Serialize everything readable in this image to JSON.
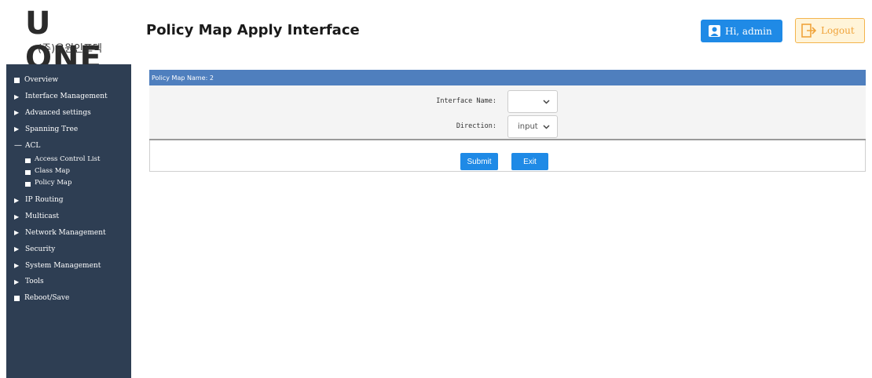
{
  "header": {
    "logo_main": "U ONE",
    "logo_sub": "(주)유원인포텍",
    "title": "Policy Map Apply Interface",
    "user_label": "Hi, admin",
    "logout_label": "Logout",
    "colors": {
      "user_btn": "#1f8ae6",
      "logout_border": "#f3b44d",
      "logout_text": "#f0a33a"
    }
  },
  "sidebar": {
    "items": [
      {
        "label": "Overview",
        "icon": "square-icon"
      },
      {
        "label": "Interface Management",
        "icon": "triangle-right-icon"
      },
      {
        "label": "Advanced settings",
        "icon": "triangle-right-icon"
      },
      {
        "label": "Spanning Tree",
        "icon": "triangle-right-icon"
      },
      {
        "label": "ACL",
        "icon": "minus-icon",
        "expanded": true,
        "children": [
          "Access Control List",
          "Class Map",
          "Policy Map"
        ]
      },
      {
        "label": "IP Routing",
        "icon": "triangle-right-icon"
      },
      {
        "label": "Multicast",
        "icon": "triangle-right-icon"
      },
      {
        "label": "Network Management",
        "icon": "triangle-right-icon"
      },
      {
        "label": "Security",
        "icon": "triangle-right-icon"
      },
      {
        "label": "System Management",
        "icon": "triangle-right-icon"
      },
      {
        "label": "Tools",
        "icon": "triangle-right-icon"
      },
      {
        "label": "Reboot/Save",
        "icon": "square-icon"
      }
    ],
    "background": "#2e3e53"
  },
  "panel": {
    "heading": "Policy Map Name: 2",
    "heading_color": "#4f7fbe",
    "interface_label": "Interface Name:",
    "interface_value": "",
    "direction_label": "Direction:",
    "direction_value": "input",
    "submit_label": "Submit",
    "exit_label": "Exit"
  }
}
